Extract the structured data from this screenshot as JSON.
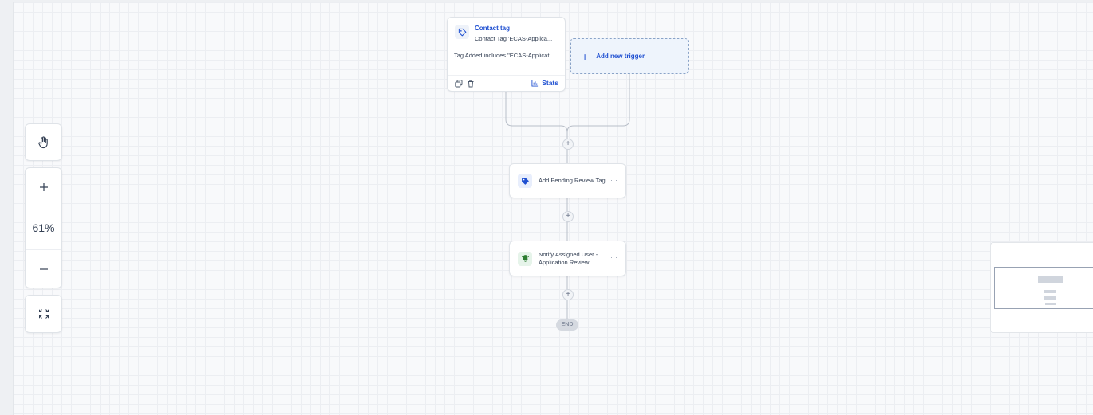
{
  "trigger": {
    "title": "Contact tag",
    "subtitle": "Contact Tag 'ECAS-Applica...",
    "condition": "Tag Added includes \"ECAS-Applicat...",
    "stats_label": "Stats",
    "icon": "tag-outline-icon"
  },
  "add_trigger": {
    "label": "Add new trigger"
  },
  "actions": [
    {
      "label": "Add Pending Review Tag",
      "icon": "tag-filled-icon",
      "icon_color": "#1e4fd1",
      "icon_bg": "#e8eefc"
    },
    {
      "label": "Notify Assigned User - Application Review",
      "icon": "bell-icon",
      "icon_color": "#2e7d32",
      "icon_bg": "#e6f4ea"
    }
  ],
  "end_label": "END",
  "toolbar": {
    "zoom": "61%",
    "pan_icon": "hand-icon",
    "zoom_in_icon": "plus-icon",
    "zoom_out_icon": "minus-icon",
    "fit_icon": "fit-screen-icon"
  },
  "colors": {
    "accent": "#1e4fd1",
    "connector": "#b8bec8"
  }
}
